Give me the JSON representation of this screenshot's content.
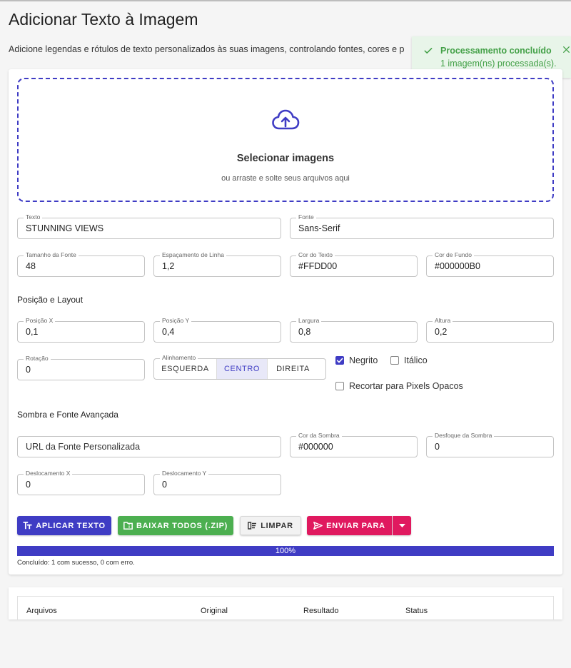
{
  "page": {
    "title": "Adicionar Texto à Imagem",
    "description": "Adicione legendas e rótulos de texto personalizados às suas imagens, controlando fontes, cores e p"
  },
  "toast": {
    "title": "Processamento concluído",
    "message": "1 imagem(ns) processada(s).",
    "color": "#43a047",
    "icon": "check-icon",
    "close_icon": "close-icon"
  },
  "upload": {
    "title": "Selecionar imagens",
    "subtitle": "ou arraste e solte seus arquivos aqui",
    "icon": "cloud-upload-icon",
    "accent": "#3f3cc4"
  },
  "fields": {
    "text": {
      "label": "Texto",
      "value": "STUNNING VIEWS"
    },
    "font": {
      "label": "Fonte",
      "value": "Sans-Serif"
    },
    "font_size": {
      "label": "Tamanho da Fonte",
      "value": "48"
    },
    "line_spacing": {
      "label": "Espaçamento de Linha",
      "value": "1,2"
    },
    "text_color": {
      "label": "Cor do Texto",
      "value": "#FFDD00"
    },
    "bg_color": {
      "label": "Cor de Fundo",
      "value": "#000000B0"
    },
    "pos_x": {
      "label": "Posição X",
      "value": "0,1"
    },
    "pos_y": {
      "label": "Posição Y",
      "value": "0,4"
    },
    "width": {
      "label": "Largura",
      "value": "0,8"
    },
    "height": {
      "label": "Altura",
      "value": "0,2"
    },
    "rotation": {
      "label": "Rotação",
      "value": "0"
    },
    "custom_font_url": {
      "placeholder": "URL da Fonte Personalizada"
    },
    "shadow_color": {
      "label": "Cor da Sombra",
      "value": "#000000"
    },
    "shadow_blur": {
      "label": "Desfoque da Sombra",
      "value": "0"
    },
    "offset_x": {
      "label": "Deslocamento X",
      "value": "0"
    },
    "offset_y": {
      "label": "Deslocamento Y",
      "value": "0"
    }
  },
  "sections": {
    "position_layout": "Posição e Layout",
    "shadow_advanced": "Sombra e Fonte Avançada"
  },
  "alignment": {
    "label": "Alinhamento",
    "options": [
      "ESQUERDA",
      "CENTRO",
      "DIREITA"
    ],
    "selected": "CENTRO"
  },
  "checkboxes": {
    "bold": {
      "label": "Negrito",
      "checked": true
    },
    "italic": {
      "label": "Itálico",
      "checked": false
    },
    "crop": {
      "label": "Recortar para Pixels Opacos",
      "checked": false
    }
  },
  "buttons": {
    "apply": {
      "label": "APLICAR TEXTO",
      "icon": "text-size-icon",
      "color": "#3f3cc4"
    },
    "download": {
      "label": "BAIXAR TODOS (.ZIP)",
      "icon": "folder-zip-icon",
      "color": "#4caf50"
    },
    "clear": {
      "label": "LIMPAR",
      "icon": "clear-all-icon"
    },
    "send": {
      "label": "ENVIAR PARA",
      "icon": "send-icon",
      "color": "#e0195f"
    },
    "send_menu_icon": "caret-down-icon"
  },
  "progress": {
    "value": 1.0,
    "label": "100%",
    "status": "Concluído: 1 com sucesso, 0 com erro."
  },
  "table": {
    "headers": [
      "Arquivos",
      "Original",
      "Resultado",
      "Status"
    ]
  }
}
